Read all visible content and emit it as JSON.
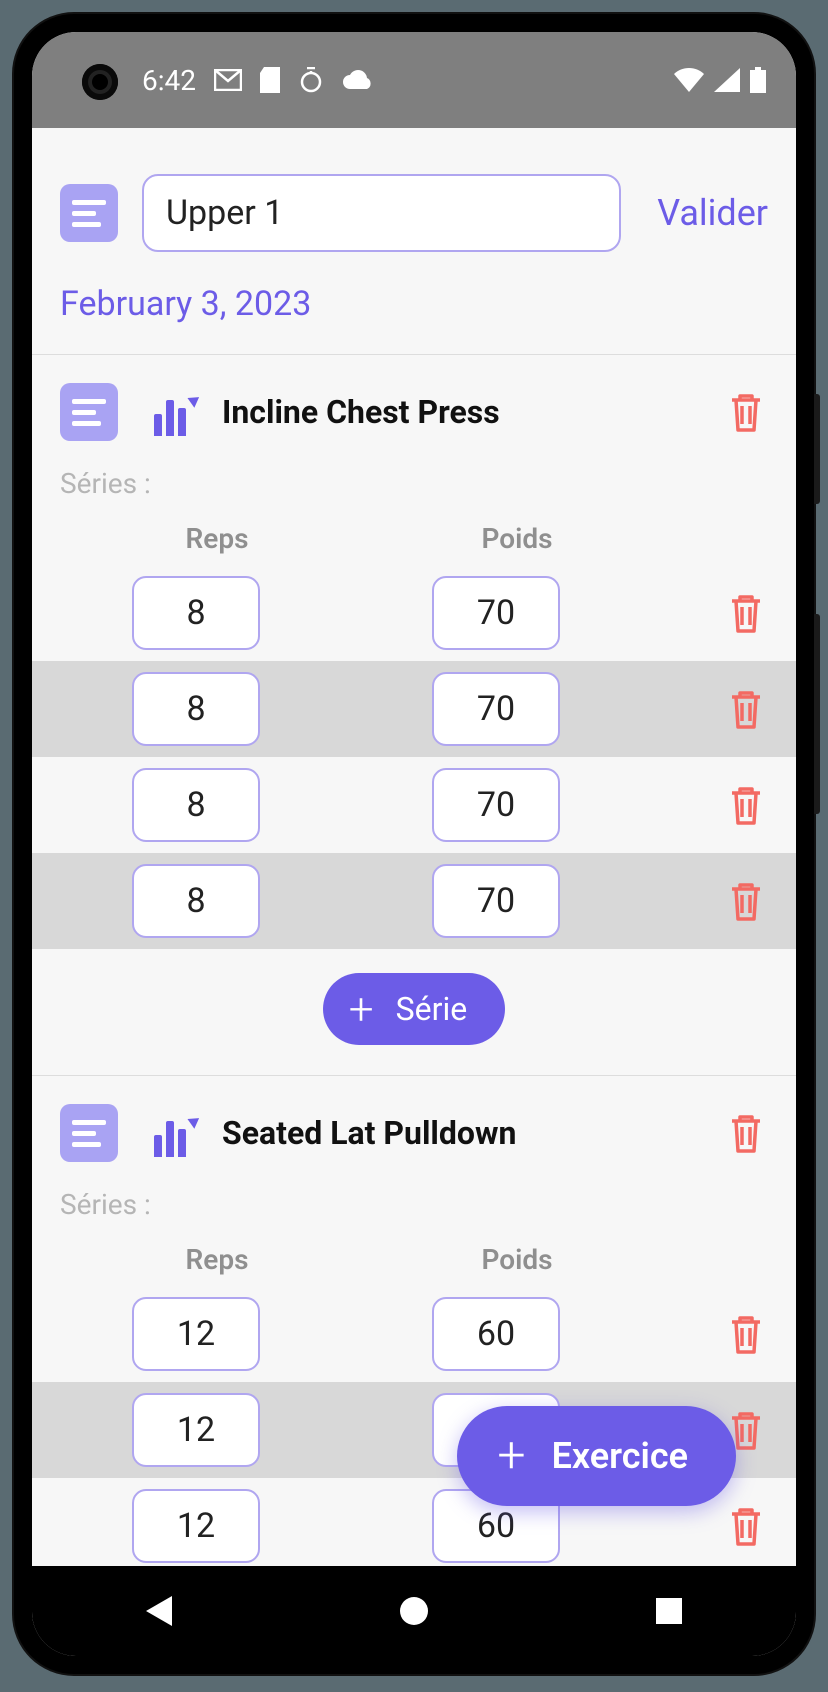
{
  "status_bar": {
    "time": "6:42",
    "icons_left": [
      "gmail",
      "sd-card",
      "timer",
      "cloud"
    ],
    "icons_right": [
      "wifi",
      "signal",
      "battery"
    ]
  },
  "header": {
    "title_value": "Upper 1",
    "validate_label": "Valider"
  },
  "date": "February 3, 2023",
  "columns": {
    "reps": "Reps",
    "poids": "Poids"
  },
  "series_label": "Séries :",
  "add_set_label": "Série",
  "fab_label": "Exercice",
  "exercises": [
    {
      "name": "Incline Chest Press",
      "sets": [
        {
          "reps": "8",
          "poids": "70"
        },
        {
          "reps": "8",
          "poids": "70"
        },
        {
          "reps": "8",
          "poids": "70"
        },
        {
          "reps": "8",
          "poids": "70"
        }
      ]
    },
    {
      "name": "Seated Lat Pulldown",
      "sets": [
        {
          "reps": "12",
          "poids": "60"
        },
        {
          "reps": "12",
          "poids": ""
        },
        {
          "reps": "12",
          "poids": "60"
        }
      ]
    }
  ],
  "colors": {
    "accent": "#6c5ce7",
    "accent_light": "#a9a3f3",
    "danger": "#f36a63"
  }
}
